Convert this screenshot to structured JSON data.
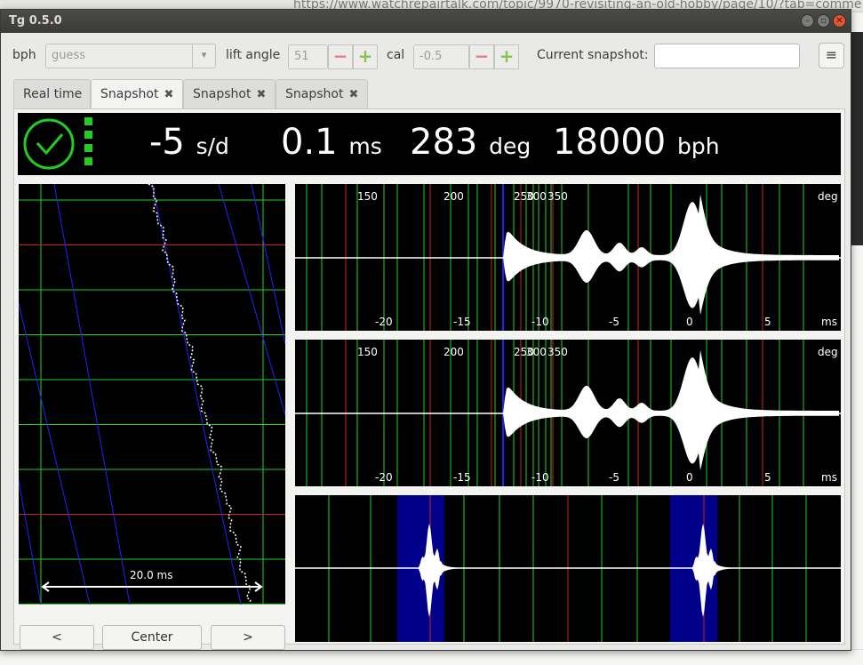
{
  "background": {
    "url": "https://www.watchrepairtalk.com/topic/9970-revisiting-an-old-hobby/page/10/?tab=comme"
  },
  "window": {
    "title": "Tg 0.5.0"
  },
  "toolbar": {
    "bph_label": "bph",
    "bph_value": "guess",
    "lift_label": "lift angle",
    "lift_value": "51",
    "cal_label": "cal",
    "cal_value": "-0.5",
    "snapshot_label": "Current snapshot:",
    "snapshot_value": "",
    "menu_icon": "hamburger-icon"
  },
  "tabs": [
    {
      "label": "Real time",
      "closable": false,
      "active": false
    },
    {
      "label": "Snapshot",
      "closable": true,
      "active": true
    },
    {
      "label": "Snapshot",
      "closable": true,
      "active": false
    },
    {
      "label": "Snapshot",
      "closable": true,
      "active": false
    }
  ],
  "readout": {
    "status_icon": "clock-ok-icon",
    "rate_value": "-5",
    "rate_unit": "s/d",
    "beat_error_value": "0.1",
    "beat_error_unit": "ms",
    "amplitude_value": "283",
    "amplitude_unit": "deg",
    "bph_value": "18000",
    "bph_unit": "bph",
    "colors": {
      "ok": "#22cc22",
      "text": "#ffffff",
      "bg": "#000000"
    }
  },
  "paperstrip": {
    "scale_label": "20.0 ms"
  },
  "waveforms": {
    "deg_ticks": [
      "150",
      "200",
      "250",
      "300",
      "350"
    ],
    "deg_unit": "deg",
    "ms_ticks": [
      "-20",
      "-15",
      "-10",
      "-5",
      "0",
      "5"
    ],
    "ms_unit": "ms"
  },
  "nav": {
    "prev_label": "<",
    "center_label": "Center",
    "next_label": ">"
  },
  "colors": {
    "grid_green": "#1fd01f",
    "grid_red": "#d01f1f",
    "trace_blue": "#2020ff",
    "pulse_bg": "#00008b"
  }
}
